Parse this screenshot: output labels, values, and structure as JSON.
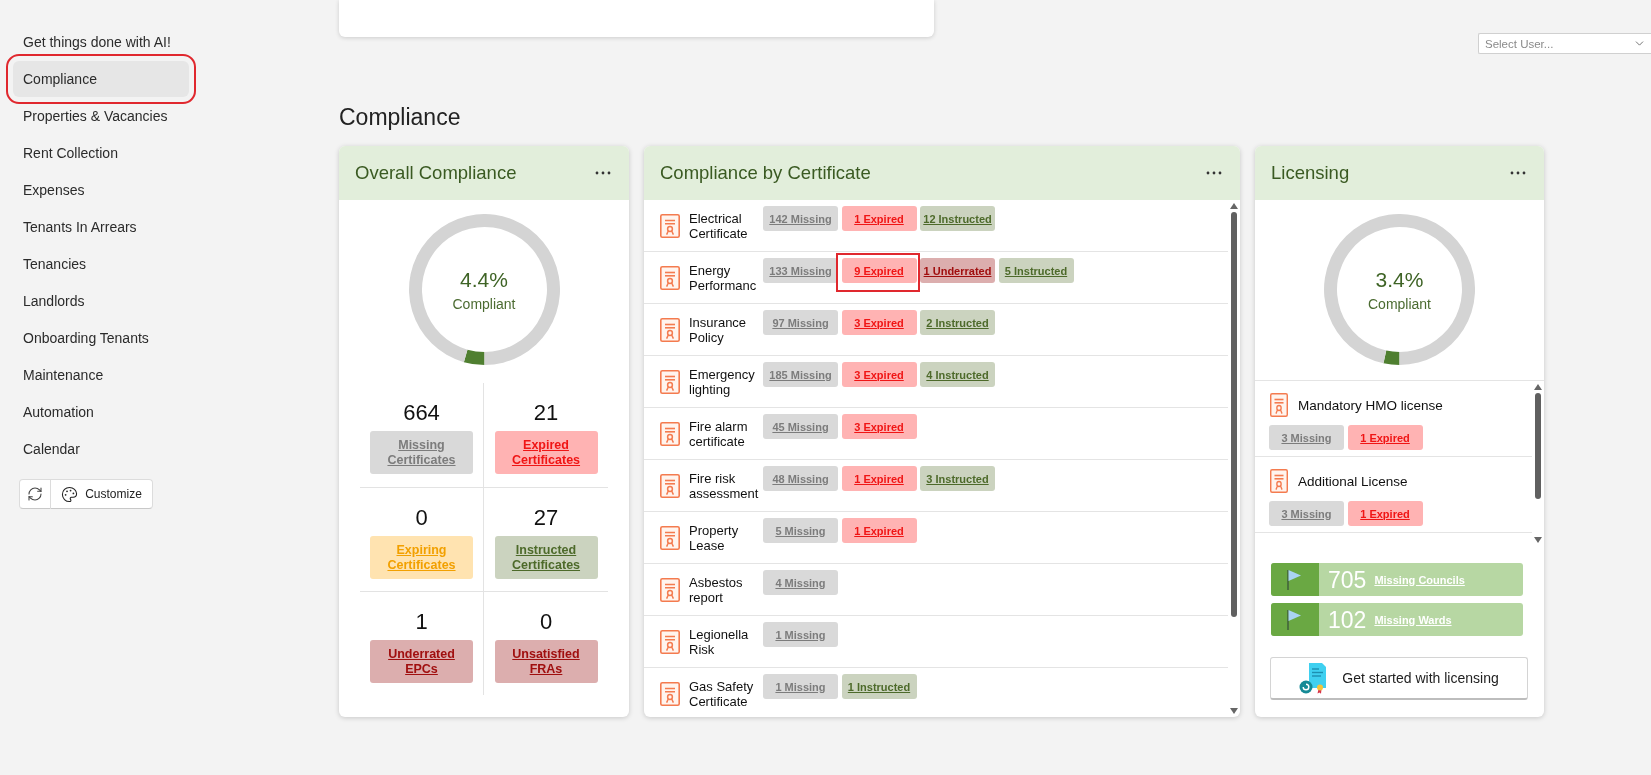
{
  "sidebar": {
    "items": [
      {
        "label": "Get things done with AI!",
        "selected": false,
        "highlighted": false
      },
      {
        "label": "Compliance",
        "selected": true,
        "highlighted": true
      },
      {
        "label": "Properties & Vacancies",
        "selected": false,
        "highlighted": false
      },
      {
        "label": "Rent Collection",
        "selected": false,
        "highlighted": false
      },
      {
        "label": "Expenses",
        "selected": false,
        "highlighted": false
      },
      {
        "label": "Tenants In Arrears",
        "selected": false,
        "highlighted": false
      },
      {
        "label": "Tenancies",
        "selected": false,
        "highlighted": false
      },
      {
        "label": "Landlords",
        "selected": false,
        "highlighted": false
      },
      {
        "label": "Onboarding Tenants",
        "selected": false,
        "highlighted": false
      },
      {
        "label": "Maintenance",
        "selected": false,
        "highlighted": false
      },
      {
        "label": "Automation",
        "selected": false,
        "highlighted": false
      },
      {
        "label": "Calendar",
        "selected": false,
        "highlighted": false
      }
    ],
    "customize_button": {
      "label": "Customize"
    }
  },
  "user_select": {
    "placeholder": "Select User..."
  },
  "page_title": "Compliance",
  "overall_compliance": {
    "title": "Overall Compliance",
    "gauge": {
      "value": "4.4%",
      "caption": "Compliant",
      "chart_data": {
        "type": "donut",
        "values": [
          4.4,
          95.6
        ]
      }
    },
    "stats": [
      {
        "kind": "missing",
        "count": "664",
        "label": "Missing Certificates"
      },
      {
        "kind": "expired",
        "count": "21",
        "label": "Expired Certificates"
      },
      {
        "kind": "expiring",
        "count": "0",
        "label": "Expiring Certificates"
      },
      {
        "kind": "instructed",
        "count": "27",
        "label": "Instructed Certificates"
      },
      {
        "kind": "underrated",
        "count": "1",
        "label": "Underrated EPCs"
      },
      {
        "kind": "unsatisfied",
        "count": "0",
        "label": "Unsatisfied FRAs"
      }
    ]
  },
  "compliance_by_certificate": {
    "title": "Compliance by Certificate",
    "rows": [
      {
        "name": "Electrical Certificate",
        "badges": [
          {
            "kind": "missing",
            "label": "142 Missing",
            "highlighted": false
          },
          {
            "kind": "expired",
            "label": "1 Expired",
            "highlighted": false
          },
          {
            "kind": "instructed",
            "label": "12 Instructed",
            "highlighted": false
          }
        ]
      },
      {
        "name": "Energy Performanc",
        "badges": [
          {
            "kind": "missing",
            "label": "133 Missing",
            "highlighted": false
          },
          {
            "kind": "expired",
            "label": "9 Expired",
            "highlighted": true
          },
          {
            "kind": "underrated",
            "label": "1 Underrated",
            "highlighted": false
          },
          {
            "kind": "instructed",
            "label": "5 Instructed",
            "highlighted": false
          }
        ]
      },
      {
        "name": "Insurance Policy",
        "badges": [
          {
            "kind": "missing",
            "label": "97 Missing",
            "highlighted": false
          },
          {
            "kind": "expired",
            "label": "3 Expired",
            "highlighted": false
          },
          {
            "kind": "instructed",
            "label": "2 Instructed",
            "highlighted": false
          }
        ]
      },
      {
        "name": "Emergency lighting",
        "badges": [
          {
            "kind": "missing",
            "label": "185 Missing",
            "highlighted": false
          },
          {
            "kind": "expired",
            "label": "3 Expired",
            "highlighted": false
          },
          {
            "kind": "instructed",
            "label": "4 Instructed",
            "highlighted": false
          }
        ]
      },
      {
        "name": "Fire alarm certificate",
        "badges": [
          {
            "kind": "missing",
            "label": "45 Missing",
            "highlighted": false
          },
          {
            "kind": "expired",
            "label": "3 Expired",
            "highlighted": false
          }
        ]
      },
      {
        "name": "Fire risk assessment",
        "badges": [
          {
            "kind": "missing",
            "label": "48 Missing",
            "highlighted": false
          },
          {
            "kind": "expired",
            "label": "1 Expired",
            "highlighted": false
          },
          {
            "kind": "instructed",
            "label": "3 Instructed",
            "highlighted": false
          }
        ]
      },
      {
        "name": "Property Lease",
        "badges": [
          {
            "kind": "missing",
            "label": "5 Missing",
            "highlighted": false
          },
          {
            "kind": "expired",
            "label": "1 Expired",
            "highlighted": false
          }
        ]
      },
      {
        "name": "Asbestos report",
        "badges": [
          {
            "kind": "missing",
            "label": "4 Missing",
            "highlighted": false
          }
        ]
      },
      {
        "name": "Legionella Risk",
        "badges": [
          {
            "kind": "missing",
            "label": "1 Missing",
            "highlighted": false
          }
        ]
      },
      {
        "name": "Gas Safety Certificate",
        "badges": [
          {
            "kind": "missing",
            "label": "1 Missing",
            "highlighted": false
          },
          {
            "kind": "instructed",
            "label": "1 Instructed",
            "highlighted": false
          }
        ]
      }
    ]
  },
  "licensing": {
    "title": "Licensing",
    "gauge": {
      "value": "3.4%",
      "caption": "Compliant",
      "chart_data": {
        "type": "donut",
        "values": [
          3.4,
          96.6
        ]
      }
    },
    "licenses": [
      {
        "name": "Mandatory HMO license",
        "badges": [
          {
            "kind": "missing",
            "label": "3 Missing"
          },
          {
            "kind": "expired",
            "label": "1 Expired"
          }
        ]
      },
      {
        "name": "Additional License",
        "badges": [
          {
            "kind": "missing",
            "label": "3 Missing"
          },
          {
            "kind": "expired",
            "label": "1 Expired"
          }
        ]
      }
    ],
    "summaries": [
      {
        "count": "705",
        "label": "Missing Councils"
      },
      {
        "count": "102",
        "label": "Missing Wards"
      }
    ],
    "cta_button": {
      "label": "Get started with licensing"
    }
  }
}
